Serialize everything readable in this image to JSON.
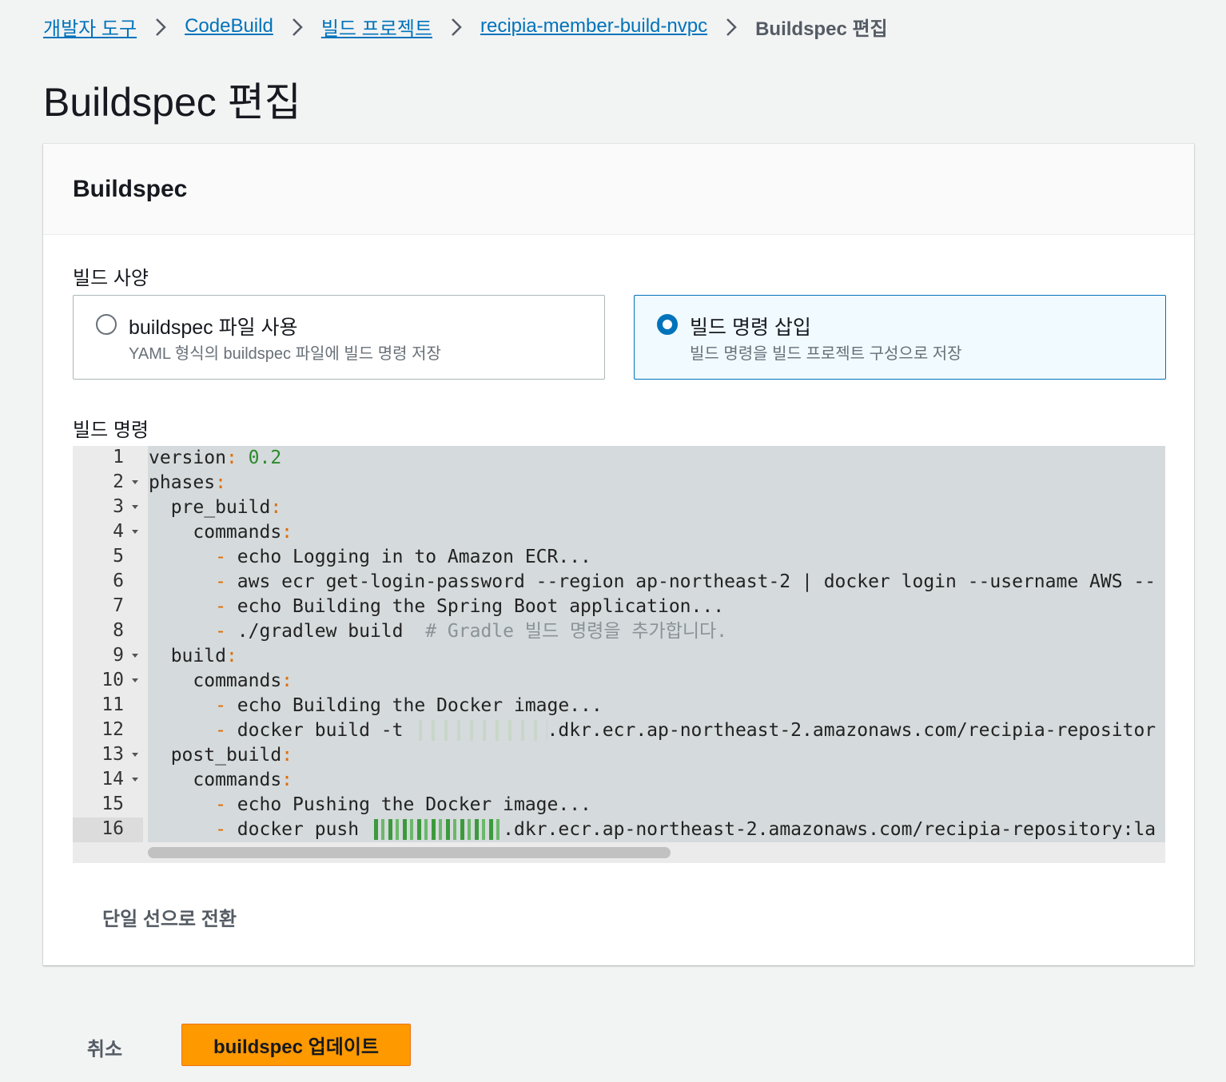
{
  "breadcrumb": {
    "items": [
      "개발자 도구",
      "CodeBuild",
      "빌드 프로젝트",
      "recipia-member-build-nvpc"
    ],
    "current": "Buildspec 편집"
  },
  "page": {
    "title": "Buildspec 편집"
  },
  "panel": {
    "title": "Buildspec",
    "build_spec_label": "빌드 사양",
    "options": [
      {
        "title": "buildspec 파일 사용",
        "description": "YAML 형식의 buildspec 파일에 빌드 명령 저장",
        "selected": false
      },
      {
        "title": "빌드 명령 삽입",
        "description": "빌드 명령을 빌드 프로젝트 구성으로 저장",
        "selected": true
      }
    ],
    "commands_label": "빌드 명령",
    "toggle_label": "단일 선으로 전환"
  },
  "editor": {
    "line_numbers": [
      "1",
      "2",
      "3",
      "4",
      "5",
      "6",
      "7",
      "8",
      "9",
      "10",
      "11",
      "12",
      "13",
      "14",
      "15",
      "16"
    ],
    "foldable_lines": [
      2,
      3,
      4,
      9,
      10,
      13,
      14
    ],
    "active_line": 16,
    "lines": {
      "l1_key": "version",
      "l1_val": "0.2",
      "l2_key": "phases",
      "l3_key": "pre_build",
      "l4_key": "commands",
      "l5_text": "echo Logging in to Amazon ECR...",
      "l6_text": "aws ecr get-login-password --region ap-northeast-2 | docker login --username AWS --",
      "l7_text": "echo Building the Spring Boot application...",
      "l8_text": "./gradlew build",
      "l8_comment": "# Gradle 빌드 명령을 추가합니다.",
      "l9_key": "build",
      "l10_key": "commands",
      "l11_text": "echo Building the Docker image...",
      "l12_prefix": "docker build -t",
      "l12_suffix": ".dkr.ecr.ap-northeast-2.amazonaws.com/recipia-repositor",
      "l13_key": "post_build",
      "l14_key": "commands",
      "l15_text": "echo Pushing the Docker image...",
      "l16_prefix": "docker push",
      "l16_suffix": ".dkr.ecr.ap-northeast-2.amazonaws.com/recipia-repository:la"
    },
    "syntax_colors": {
      "punctuation": "#e06c00",
      "number": "#2b8a2b",
      "comment": "#8a9399"
    }
  },
  "actions": {
    "cancel_label": "취소",
    "submit_label": "buildspec 업데이트"
  },
  "colors": {
    "link": "#0073bb",
    "primary": "#ff9900",
    "selected_border": "#0073bb"
  }
}
